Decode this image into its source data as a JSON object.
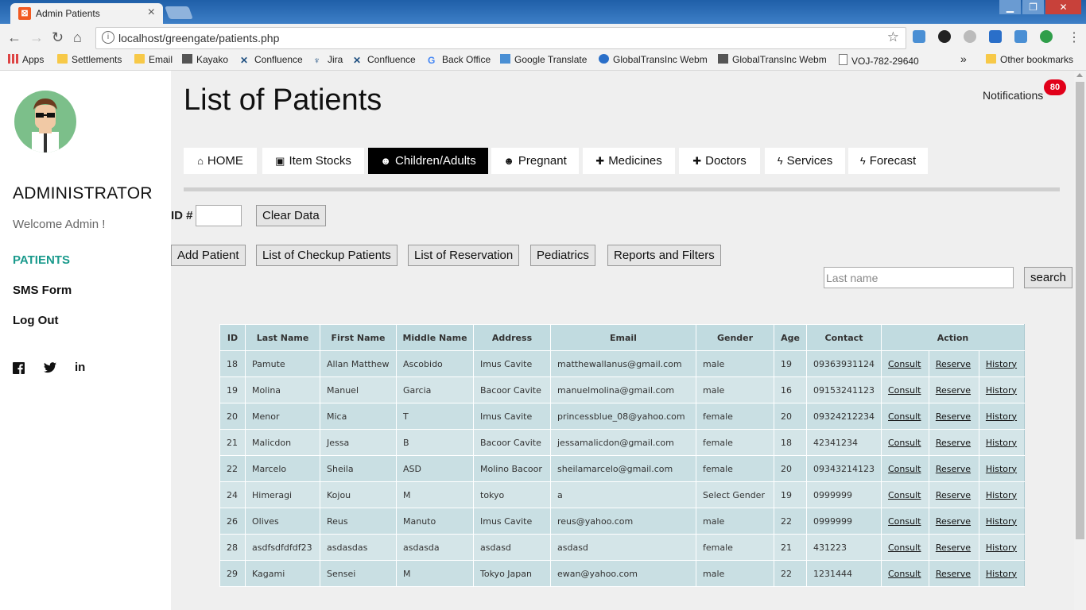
{
  "browser": {
    "tab_title": "Admin Patients",
    "tab_close": "×",
    "url": "localhost/greengate/patients.php",
    "window_controls": [
      "▁",
      "❐",
      "✕"
    ]
  },
  "bookmarks": {
    "items": [
      "Apps",
      "Settlements",
      "Email",
      "Kayako",
      "Confluence",
      "Jira",
      "Confluence",
      "Back Office",
      "Google Translate",
      "GlobalTransInc Webm",
      "GlobalTransInc Webm",
      "VOJ-782-29640"
    ],
    "overflow": "»",
    "other": "Other bookmarks"
  },
  "sidebar": {
    "role": "ADMINISTRATOR",
    "welcome": "Welcome Admin !",
    "nav": [
      "PATIENTS",
      "SMS Form",
      "Log Out"
    ],
    "social": [
      "facebook-icon",
      "twitter-icon",
      "linkedin-icon"
    ]
  },
  "header": {
    "title": "List of Patients",
    "notifications_label": "Notifications",
    "notifications_count": "80"
  },
  "tabs": [
    {
      "label": "HOME",
      "icon": "home-icon",
      "glyph": "⌂"
    },
    {
      "label": "Item Stocks",
      "icon": "briefcase-icon",
      "glyph": "▣"
    },
    {
      "label": "Children/Adults",
      "icon": "users-icon",
      "glyph": "☻"
    },
    {
      "label": "Pregnant",
      "icon": "users-icon",
      "glyph": "☻"
    },
    {
      "label": "Medicines",
      "icon": "medkit-icon",
      "glyph": "✚"
    },
    {
      "label": "Doctors",
      "icon": "medkit-icon",
      "glyph": "✚"
    },
    {
      "label": "Services",
      "icon": "bolt-icon",
      "glyph": "ϟ"
    },
    {
      "label": "Forecast",
      "icon": "bolt-icon",
      "glyph": "ϟ"
    }
  ],
  "active_tab": "Children/Adults",
  "controls": {
    "id_label": "ID #",
    "clear_button": "Clear Data",
    "action_buttons": [
      "Add Patient",
      "List of Checkup Patients",
      "List of Reservation",
      "Pediatrics",
      "Reports and Filters"
    ],
    "search_placeholder": "Last name",
    "search_button": "search"
  },
  "table": {
    "columns": [
      "ID",
      "Last Name",
      "First Name",
      "Middle Name",
      "Address",
      "Email",
      "Gender",
      "Age",
      "Contact",
      "Action"
    ],
    "actions": [
      "Consult",
      "Reserve",
      "History"
    ],
    "rows": [
      [
        "18",
        "Pamute",
        "Allan Matthew",
        "Ascobido",
        "Imus Cavite",
        "matthewallanus@gmail.com",
        "male",
        "19",
        "09363931124"
      ],
      [
        "19",
        "Molina",
        "Manuel",
        "Garcia",
        "Bacoor Cavite",
        "manuelmolina@gmail.com",
        "male",
        "16",
        "09153241123"
      ],
      [
        "20",
        "Menor",
        "Mica",
        "T",
        "Imus Cavite",
        "princessblue_08@yahoo.com",
        "female",
        "20",
        "09324212234"
      ],
      [
        "21",
        "Malicdon",
        "Jessa",
        "B",
        "Bacoor Cavite",
        "jessamalicdon@gmail.com",
        "female",
        "18",
        "42341234"
      ],
      [
        "22",
        "Marcelo",
        "Sheila",
        "ASD",
        "Molino Bacoor",
        "sheilamarcelo@gmail.com",
        "female",
        "20",
        "09343214123"
      ],
      [
        "24",
        "Himeragi",
        "Kojou",
        "M",
        "tokyo",
        "a",
        "Select Gender",
        "19",
        "0999999"
      ],
      [
        "26",
        "Olives",
        "Reus",
        "Manuto",
        "Imus Cavite",
        "reus@yahoo.com",
        "male",
        "22",
        "0999999"
      ],
      [
        "28",
        "asdfsdfdfdf23",
        "asdasdas",
        "asdasda",
        "asdasd",
        "asdasd",
        "female",
        "21",
        "431223"
      ],
      [
        "29",
        "Kagami",
        "Sensei",
        "M",
        "Tokyo Japan",
        "ewan@yahoo.com",
        "male",
        "22",
        "1231444"
      ]
    ]
  },
  "colors": {
    "active_nav": "#1a9a8c",
    "badge": "#e1001a",
    "table_header": "#c1dbe0"
  }
}
